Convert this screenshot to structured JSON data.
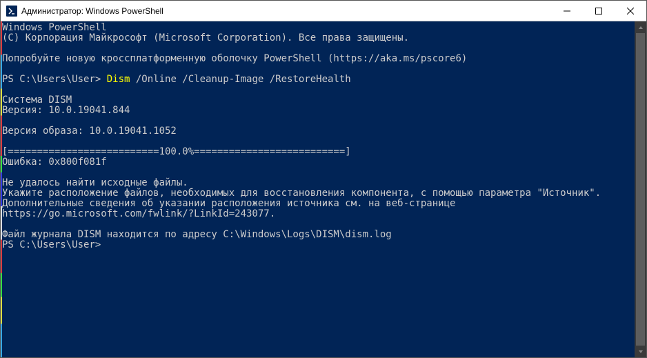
{
  "titlebar": {
    "title": "Администратор: Windows PowerShell"
  },
  "terminal": {
    "line_ps_header": "Windows PowerShell",
    "line_copyright": "(C) Корпорация Майкрософт (Microsoft Corporation). Все права защищены.",
    "line_try": "Попробуйте новую кроссплатформенную оболочку PowerShell (https://aka.ms/pscore6)",
    "prompt1": "PS C:\\Users\\User> ",
    "cmd_dism": "Dism",
    "cmd_args": " /Online /Cleanup-Image /RestoreHealth",
    "line_system": "Система DISM",
    "line_version": "Версия: 10.0.19041.844",
    "line_image_version": "Версия образа: 10.0.19041.1052",
    "line_progress": "[==========================100.0%==========================]",
    "line_error": "Ошибка: 0x800f081f",
    "line_notfound": "Не удалось найти исходные файлы.",
    "line_advice": "Укажите расположение файлов, необходимых для восстановления компонента, с помощью параметра \"Источник\". Дополнительные сведения об указании расположения источника см. на веб-странице https://go.microsoft.com/fwlink/?LinkId=243077.",
    "line_log": "Файл журнала DISM находится по адресу C:\\Windows\\Logs\\DISM\\dism.log",
    "prompt2": "PS C:\\Users\\User>"
  }
}
